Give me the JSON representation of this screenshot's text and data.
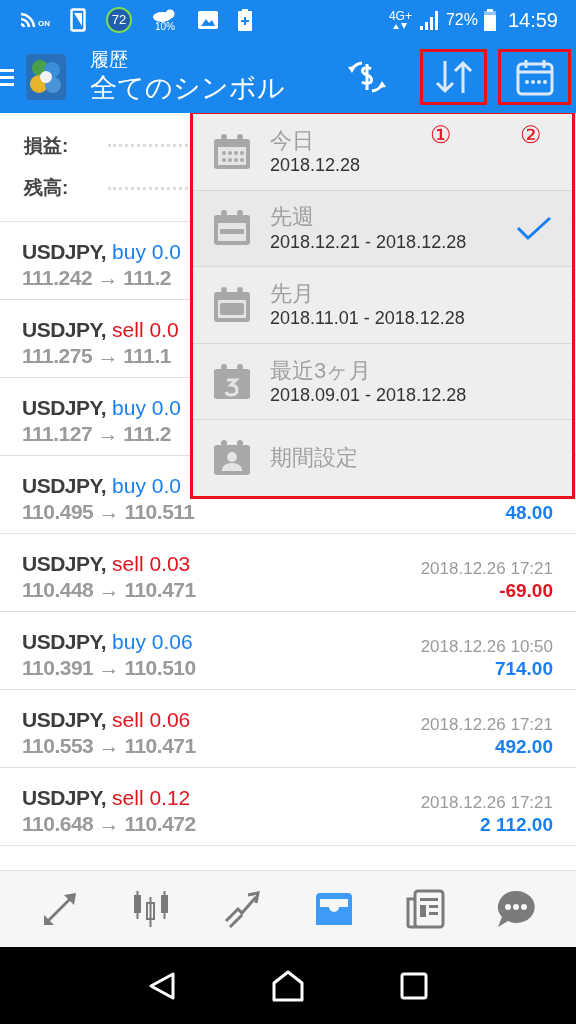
{
  "status_bar": {
    "nfc": "ON",
    "badge": "72",
    "weather": "10%",
    "network": "4G+",
    "battery": "72%",
    "time": "14:59"
  },
  "app_bar": {
    "subtitle": "履歴",
    "title": "全てのシンボル",
    "annotations": [
      "①",
      "②"
    ]
  },
  "summary": [
    {
      "label": "損益:"
    },
    {
      "label": "残高:"
    }
  ],
  "trades": [
    {
      "symbol": "USDJPY,",
      "side": "buy 0.0",
      "kind": "buy",
      "prices": "111.242 → 111.2"
    },
    {
      "symbol": "USDJPY,",
      "side": "sell 0.0",
      "kind": "sell",
      "prices": "111.275 → 111.1"
    },
    {
      "symbol": "USDJPY,",
      "side": "buy 0.0",
      "kind": "buy",
      "prices": "111.127 → 111.2"
    },
    {
      "symbol": "USDJPY,",
      "side": "buy 0.0",
      "kind": "buy",
      "prices": "110.495 → 110.511",
      "profit": "48.00",
      "color": "#1a7ff0"
    },
    {
      "symbol": "USDJPY,",
      "side": "sell 0.03",
      "kind": "sell",
      "prices": "110.448 → 110.471",
      "time": "2018.12.26 17:21",
      "profit": "-69.00",
      "color": "#e0141e"
    },
    {
      "symbol": "USDJPY,",
      "side": "buy 0.06",
      "kind": "buy",
      "prices": "110.391 → 110.510",
      "time": "2018.12.26 10:50",
      "profit": "714.00",
      "color": "#1a7ff0"
    },
    {
      "symbol": "USDJPY,",
      "side": "sell 0.06",
      "kind": "sell",
      "prices": "110.553 → 110.471",
      "time": "2018.12.26 17:21",
      "profit": "492.00",
      "color": "#1a7ff0"
    },
    {
      "symbol": "USDJPY,",
      "side": "sell 0.12",
      "kind": "sell",
      "prices": "110.648 → 110.472",
      "time": "2018.12.26 17:21",
      "profit": "2 112.00",
      "color": "#1a7ff0"
    }
  ],
  "period_menu": [
    {
      "kind": "today",
      "label": "今日",
      "range": "2018.12.28",
      "selected": false
    },
    {
      "kind": "week",
      "label": "先週",
      "range": "2018.12.21 - 2018.12.28",
      "selected": true
    },
    {
      "kind": "month",
      "label": "先月",
      "range": "2018.11.01 - 2018.12.28",
      "selected": false
    },
    {
      "kind": "quarter",
      "label": "最近3ヶ月",
      "range": "2018.09.01 - 2018.12.28",
      "selected": false
    },
    {
      "kind": "custom",
      "label": "期間設定",
      "selected": false
    }
  ],
  "bottom_nav": [
    {
      "kind": "trade",
      "selected": false
    },
    {
      "kind": "chart",
      "selected": false
    },
    {
      "kind": "trend",
      "selected": false
    },
    {
      "kind": "history",
      "selected": true
    },
    {
      "kind": "news",
      "selected": false
    },
    {
      "kind": "chat",
      "selected": false
    }
  ]
}
